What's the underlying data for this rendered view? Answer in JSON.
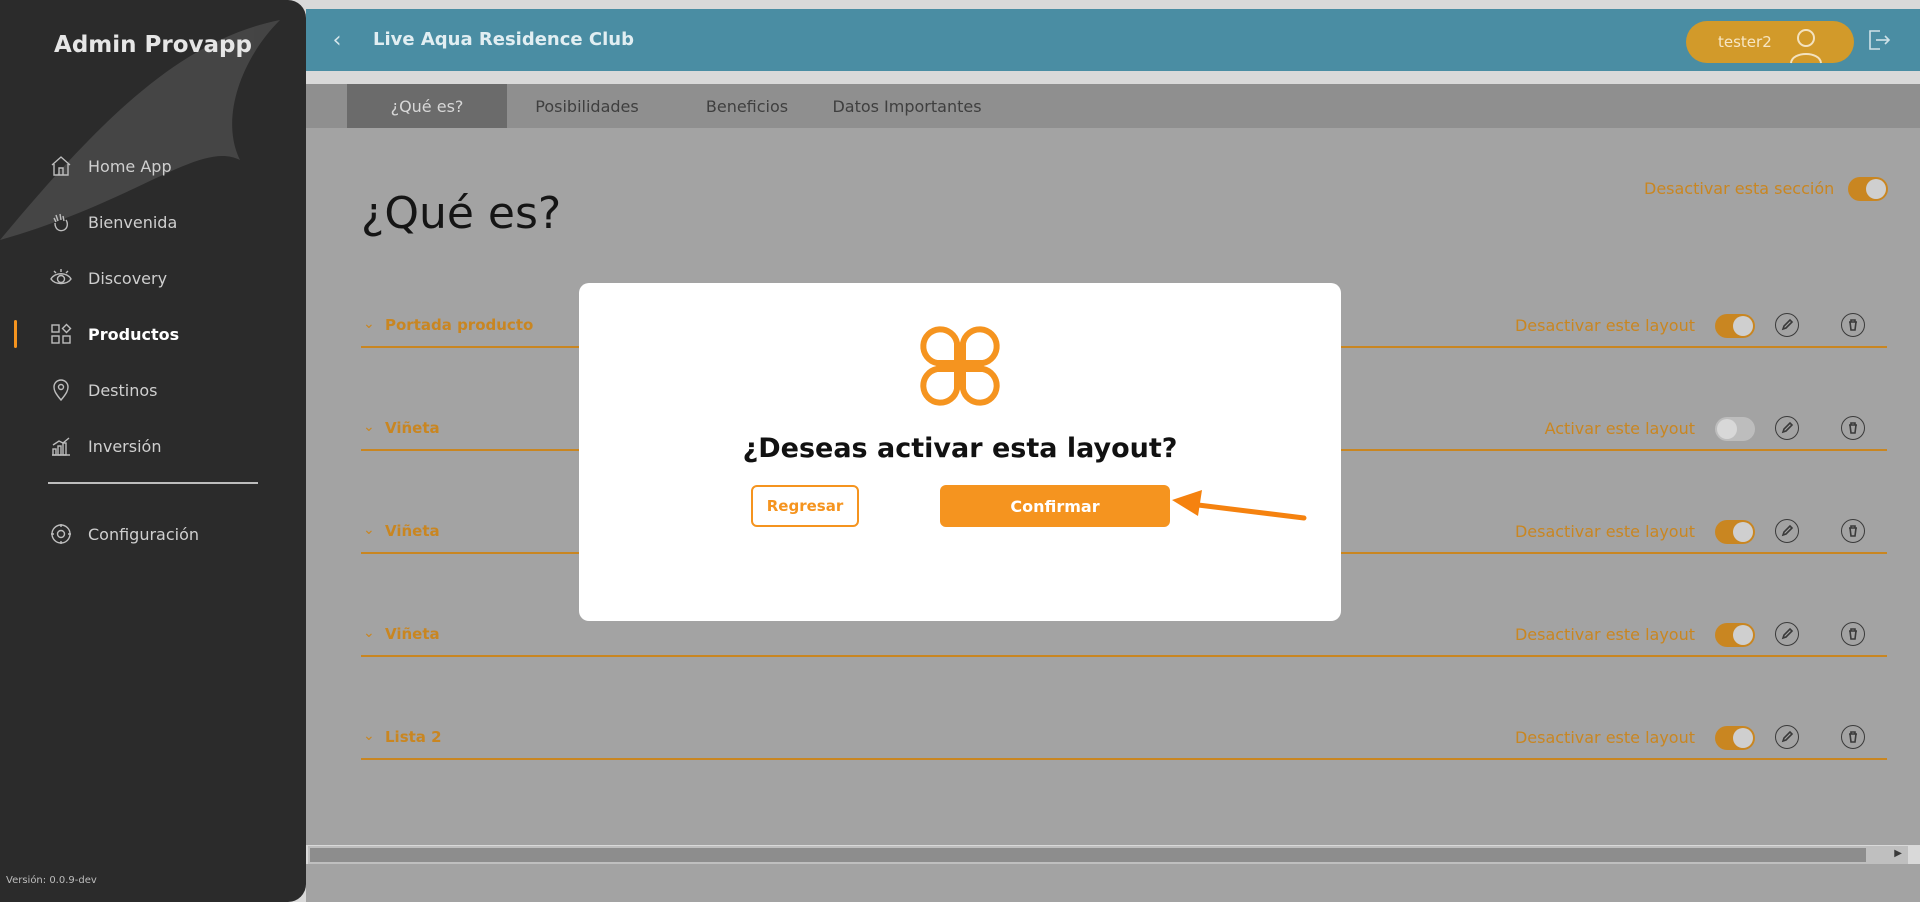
{
  "sidebar": {
    "brand": "Admin Provapp",
    "items": [
      {
        "label": "Home App",
        "icon": "home-icon"
      },
      {
        "label": "Bienvenida",
        "icon": "wave-hand-icon"
      },
      {
        "label": "Discovery",
        "icon": "eye-icon"
      },
      {
        "label": "Productos",
        "icon": "grid-icon",
        "active": true
      },
      {
        "label": "Destinos",
        "icon": "location-pin-icon"
      },
      {
        "label": "Inversión",
        "icon": "chart-icon"
      }
    ],
    "config": {
      "label": "Configuración",
      "icon": "gear-icon"
    },
    "version": "Versión: 0.0.9-dev"
  },
  "header": {
    "title": "Live Aqua Residence Club",
    "user": "tester2"
  },
  "tabs": [
    {
      "label": "¿Qué es?",
      "active": true
    },
    {
      "label": "Posibilidades"
    },
    {
      "label": "Beneficios"
    },
    {
      "label": "Datos Importantes"
    }
  ],
  "main": {
    "heading": "¿Qué es?",
    "section_toggle_label": "Desactivar esta sección",
    "section_toggle_on": true,
    "layouts": [
      {
        "name": "Portada producto",
        "status": "Desactivar este layout",
        "on": true
      },
      {
        "name": "Viñeta",
        "status": "Activar este layout",
        "on": false
      },
      {
        "name": "Viñeta",
        "status": "Desactivar este layout",
        "on": true
      },
      {
        "name": "Viñeta",
        "status": "Desactivar este layout",
        "on": true
      },
      {
        "name": "Lista 2",
        "status": "Desactivar este layout",
        "on": true
      }
    ]
  },
  "modal": {
    "question": "¿Deseas activar esta layout?",
    "back_label": "Regresar",
    "confirm_label": "Confirmar"
  },
  "colors": {
    "accent": "#f5941f",
    "sidebar_bg": "#2b2b2b",
    "header_bg": "#4a8da3"
  }
}
